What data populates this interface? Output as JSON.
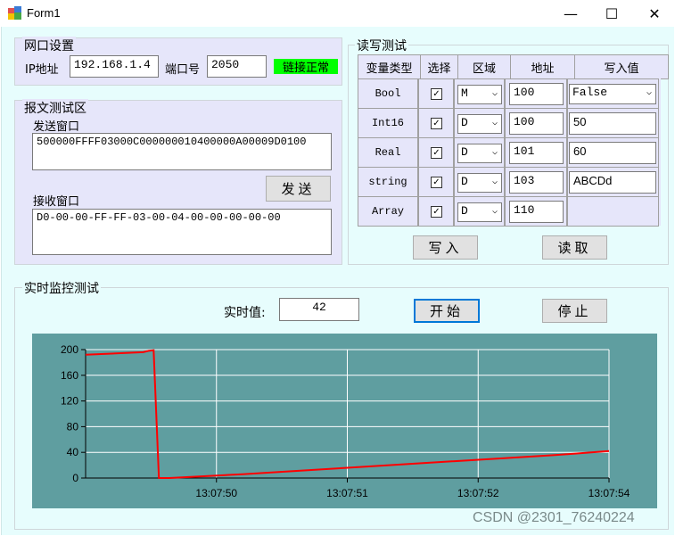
{
  "window": {
    "title": "Form1",
    "minimize": "—",
    "maximize": "☐",
    "close": "✕"
  },
  "network": {
    "group_title": "网口设置",
    "ip_label": "IP地址",
    "ip_value": "192.168.1.4",
    "port_label": "端口号",
    "port_value": "2050",
    "status": "链接正常",
    "status_color": "#00ff00"
  },
  "message": {
    "group_title": "报文测试区",
    "send_label": "发送窗口",
    "send_value": "500000FFFF03000C000000010400000A00009D0100",
    "send_button": "发送",
    "recv_label": "接收窗口",
    "recv_value": "D0-00-00-FF-FF-03-00-04-00-00-00-00-00"
  },
  "readwrite": {
    "group_title": "读写测试",
    "headers": [
      "变量类型",
      "选择",
      "区域",
      "地址",
      "写入值"
    ],
    "rows": [
      {
        "type": "Bool",
        "checked": true,
        "area": "M",
        "address": "100",
        "value": "False",
        "value_is_combo": true
      },
      {
        "type": "Int16",
        "checked": true,
        "area": "D",
        "address": "100",
        "value": "50"
      },
      {
        "type": "Real",
        "checked": true,
        "area": "D",
        "address": "101",
        "value": "60"
      },
      {
        "type": "string",
        "checked": true,
        "area": "D",
        "address": "103",
        "value": "ABCDd"
      },
      {
        "type": "Array",
        "checked": true,
        "area": "D",
        "address": "110",
        "value": ""
      }
    ],
    "write_button": "写入",
    "read_button": "读取"
  },
  "monitor": {
    "group_title": "实时监控测试",
    "realtime_label": "实时值:",
    "realtime_value": "42",
    "start_button": "开始",
    "stop_button": "停止"
  },
  "chart_data": {
    "type": "line",
    "background": "#5f9ea0",
    "line_color": "#ff0000",
    "ylim": [
      0,
      200
    ],
    "yticks": [
      0,
      40,
      80,
      120,
      160,
      200
    ],
    "xtick_labels": [
      "13:07:50",
      "13:07:51",
      "13:07:52",
      "13:07:54"
    ],
    "grid": true,
    "series": [
      {
        "values": [
          {
            "t": 0.0,
            "y": 192
          },
          {
            "t": 0.11,
            "y": 196
          },
          {
            "t": 0.12,
            "y": 198
          },
          {
            "t": 0.13,
            "y": 199
          },
          {
            "t": 0.14,
            "y": 0
          },
          {
            "t": 0.16,
            "y": 0
          },
          {
            "t": 0.3,
            "y": 6
          },
          {
            "t": 0.4,
            "y": 11
          },
          {
            "t": 0.5,
            "y": 16
          },
          {
            "t": 0.6,
            "y": 21
          },
          {
            "t": 0.7,
            "y": 26
          },
          {
            "t": 0.8,
            "y": 31
          },
          {
            "t": 0.9,
            "y": 36
          },
          {
            "t": 1.0,
            "y": 42
          }
        ]
      }
    ]
  },
  "watermark": "CSDN @2301_76240224"
}
